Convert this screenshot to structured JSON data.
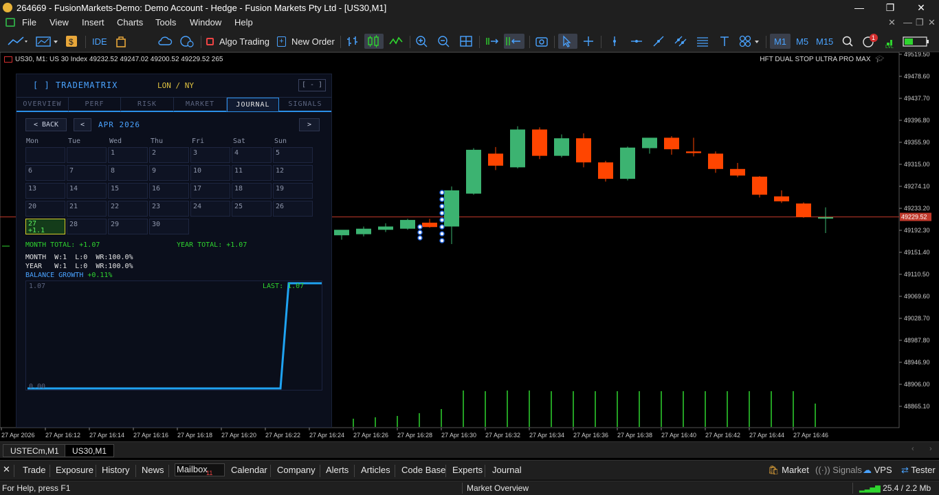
{
  "window": {
    "title": "264669 - FusionMarkets-Demo: Demo Account - Hedge - Fusion Markets Pty Ltd - [US30,M1]",
    "minimize": "—",
    "restore": "❐",
    "close": "✕"
  },
  "menu": [
    "File",
    "View",
    "Insert",
    "Charts",
    "Tools",
    "Window",
    "Help"
  ],
  "toolbar": {
    "ide": "IDE",
    "algo_trading": "Algo Trading",
    "new_order": "New Order",
    "timeframes": [
      "M1",
      "M5",
      "M15"
    ],
    "active_timeframe": "M1",
    "notification_count": "1",
    "accent": "#4aa3ff"
  },
  "chart": {
    "symbol_header": "US30, M1:  US 30 Index  49232.52 49247.02 49200.52 49229.52  265",
    "ea_name": "HFT DUAL STOP ULTRA PRO MAX",
    "current_price": "49229.52",
    "price_labels": [
      "49519.50",
      "49478.60",
      "49437.70",
      "49396.80",
      "49355.90",
      "49315.00",
      "49274.10",
      "49233.20",
      "49192.30",
      "49151.40",
      "49110.50",
      "49069.60",
      "49028.70",
      "48987.80",
      "48946.90",
      "48906.00",
      "48865.10"
    ],
    "time_labels": [
      "27 Apr 2026",
      "27 Apr 16:12",
      "27 Apr 16:14",
      "27 Apr 16:16",
      "27 Apr 16:18",
      "27 Apr 16:20",
      "27 Apr 16:22",
      "27 Apr 16:24",
      "27 Apr 16:26",
      "27 Apr 16:28",
      "27 Apr 16:30",
      "27 Apr 16:32",
      "27 Apr 16:34",
      "27 Apr 16:36",
      "27 Apr 16:38",
      "27 Apr 16:40",
      "27 Apr 16:42",
      "27 Apr 16:44",
      "27 Apr 16:46"
    ],
    "bull_color": "#3cb371",
    "bear_color": "#ff4500"
  },
  "chart_data": {
    "type": "candlestick",
    "title": "US30, M1",
    "ylim": [
      48845,
      49530
    ],
    "current_price": 49229.52,
    "candles": [
      {
        "o": 49196,
        "h": 49200,
        "l": 49188,
        "c": 49206
      },
      {
        "o": 49198,
        "h": 49212,
        "l": 49194,
        "c": 49208
      },
      {
        "o": 49206,
        "h": 49218,
        "l": 49202,
        "c": 49212
      },
      {
        "o": 49208,
        "h": 49226,
        "l": 49206,
        "c": 49224
      },
      {
        "o": 49219,
        "h": 49226,
        "l": 49210,
        "c": 49211
      },
      {
        "o": 49212,
        "h": 49285,
        "l": 49180,
        "c": 49278
      },
      {
        "o": 49272,
        "h": 49355,
        "l": 49270,
        "c": 49352
      },
      {
        "o": 49345,
        "h": 49357,
        "l": 49315,
        "c": 49323
      },
      {
        "o": 49320,
        "h": 49395,
        "l": 49318,
        "c": 49389
      },
      {
        "o": 49389,
        "h": 49393,
        "l": 49335,
        "c": 49341
      },
      {
        "o": 49341,
        "h": 49380,
        "l": 49338,
        "c": 49373
      },
      {
        "o": 49373,
        "h": 49382,
        "l": 49320,
        "c": 49329
      },
      {
        "o": 49329,
        "h": 49332,
        "l": 49294,
        "c": 49299
      },
      {
        "o": 49299,
        "h": 49358,
        "l": 49296,
        "c": 49356
      },
      {
        "o": 49355,
        "h": 49370,
        "l": 49345,
        "c": 49374
      },
      {
        "o": 49374,
        "h": 49377,
        "l": 49343,
        "c": 49353
      },
      {
        "o": 49349,
        "h": 49374,
        "l": 49340,
        "c": 49346
      },
      {
        "o": 49345,
        "h": 49349,
        "l": 49310,
        "c": 49317
      },
      {
        "o": 49317,
        "h": 49328,
        "l": 49302,
        "c": 49305
      },
      {
        "o": 49303,
        "h": 49304,
        "l": 49265,
        "c": 49270
      },
      {
        "o": 49267,
        "h": 49278,
        "l": 49255,
        "c": 49258
      },
      {
        "o": 49254,
        "h": 49256,
        "l": 49228,
        "c": 49229
      },
      {
        "o": 49229,
        "h": 49247,
        "l": 49200,
        "c": 49229
      }
    ]
  },
  "panel": {
    "title": "[ ]  TRADEMATRIX",
    "session": "LON / NY",
    "minimize": "[ - ]",
    "tabs": [
      "OVERVIEW",
      "PERF",
      "RISK",
      "MARKET",
      "JOURNAL",
      "SIGNALS"
    ],
    "active_tab": "JOURNAL",
    "back": "< BACK",
    "prev": "<",
    "next": ">",
    "month": "APR 2026",
    "weekdays": [
      "Mon",
      "Tue",
      "Wed",
      "Thu",
      "Fri",
      "Sat",
      "Sun"
    ],
    "days": [
      "1",
      "2",
      "3",
      "4",
      "5",
      "6",
      "7",
      "8",
      "9",
      "10",
      "11",
      "12",
      "13",
      "14",
      "15",
      "16",
      "17",
      "18",
      "19",
      "20",
      "21",
      "22",
      "23",
      "24",
      "25",
      "26",
      "27",
      "28",
      "29",
      "30"
    ],
    "today": "27",
    "today_pnl": "+1.1",
    "month_total": "MONTH TOTAL: +1.07",
    "year_total": "YEAR TOTAL: +1.07",
    "month_stats": "MONTH  W:1  L:0  WR:100.0%",
    "year_stats": "YEAR   W:1  L:0  WR:100.0%",
    "balance_growth_label": "BALANCE GROWTH",
    "balance_growth_value": "+0.11%",
    "graph_max": "1.07",
    "graph_min": "0.00",
    "graph_last": "LAST: 1.07"
  },
  "chart_tabs": [
    "USTECm,M1",
    "US30,M1"
  ],
  "toolbox": {
    "close": "✕",
    "tabs": [
      "Trade",
      "Exposure",
      "History",
      "News",
      "Mailbox",
      "Calendar",
      "Company",
      "Alerts",
      "Articles",
      "Code Base",
      "Experts",
      "Journal"
    ],
    "mailbox_badge": "11",
    "right": [
      "Market",
      "Signals",
      "VPS",
      "Tester"
    ]
  },
  "status": {
    "help": "For Help, press F1",
    "center": "Market Overview",
    "traffic": "25.4 / 2.2 Mb"
  }
}
